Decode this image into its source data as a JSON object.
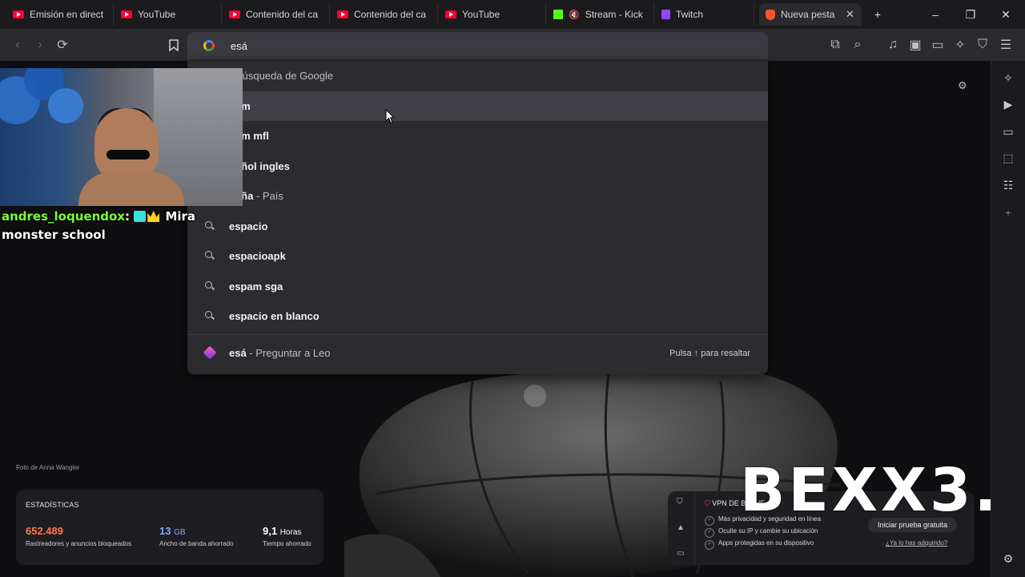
{
  "tabs": [
    {
      "label": "Emisión en direct",
      "icon": "youtube-icon",
      "active": false
    },
    {
      "label": "YouTube",
      "icon": "youtube-icon",
      "active": false
    },
    {
      "label": "Contenido del ca",
      "icon": "youtube-icon",
      "active": false
    },
    {
      "label": "Contenido del ca",
      "icon": "youtube-icon",
      "active": false
    },
    {
      "label": "YouTube",
      "icon": "youtube-icon",
      "active": false
    },
    {
      "label": "Stream - Kick",
      "icon": "kick-icon",
      "active": false
    },
    {
      "label": "Twitch",
      "icon": "twitch-icon",
      "active": false
    },
    {
      "label": "Nueva pestañ",
      "icon": "brave-icon",
      "active": true
    }
  ],
  "window": {
    "new_tab": "+",
    "minimize": "–",
    "restore": "❐",
    "close": "✕",
    "tab_close": "✕"
  },
  "urlbar": {
    "value": "esá"
  },
  "suggestions": [
    {
      "bold": "",
      "dim": "- Búsqueda de Google",
      "highlighted": false,
      "partial": true
    },
    {
      "bold": "pam",
      "dim": "",
      "highlighted": true,
      "partial": true
    },
    {
      "bold": "pam mfl",
      "dim": "",
      "highlighted": false,
      "partial": true
    },
    {
      "bold": "pañol ingles",
      "dim": "",
      "highlighted": false,
      "partial": true
    },
    {
      "bold": "paña",
      "dim": "- País",
      "highlighted": false,
      "partial": true
    },
    {
      "bold": "espacio",
      "dim": "",
      "highlighted": false,
      "partial": false
    },
    {
      "bold": "espacioapk",
      "dim": "",
      "highlighted": false,
      "partial": false
    },
    {
      "bold": "espam sga",
      "dim": "",
      "highlighted": false,
      "partial": false
    },
    {
      "bold": "espacio en blanco",
      "dim": "",
      "highlighted": false,
      "partial": false
    }
  ],
  "leo": {
    "query": "esá",
    "action": "- Preguntar a Leo",
    "hint": "Pulsa ↑ para resaltar"
  },
  "chat": {
    "user": "andres_loquendox",
    "separator": ":",
    "message": "Mira monster school"
  },
  "photo_credit": "Foto de Anna Wangler",
  "stats": {
    "title": "ESTADÍSTICAS",
    "trackers": {
      "value": "652.489",
      "label": "Rastreadores y anuncios bloqueados",
      "color": "#ff7a4d"
    },
    "bandwidth": {
      "value": "13",
      "unit": "GB",
      "label": "Ancho de banda ahorrado",
      "color": "#8aa4ff"
    },
    "time": {
      "value": "9,1",
      "unit": "Horas",
      "label": "Tiempo ahorrado",
      "color": "#ffffff"
    }
  },
  "vpn": {
    "title": "VPN DE BRAVE",
    "items": [
      "Más privacidad y seguridad en línea",
      "Oculte su IP y cambie su ubicación",
      "Apps protegidas en su dispositivo"
    ],
    "cta": "Iniciar prueba gratuita",
    "link": "¿Ya lo has adquirido?"
  },
  "watermark": "BEXX3."
}
